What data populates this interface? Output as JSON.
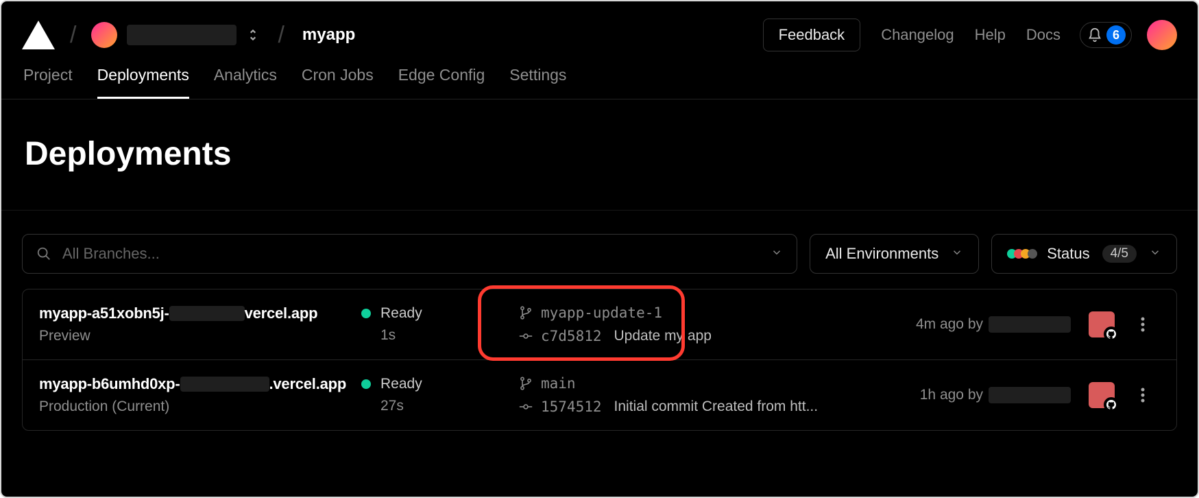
{
  "header": {
    "project_name": "myapp",
    "feedback_label": "Feedback",
    "changelog_label": "Changelog",
    "help_label": "Help",
    "docs_label": "Docs",
    "notification_count": "6"
  },
  "subnav": {
    "items": [
      "Project",
      "Deployments",
      "Analytics",
      "Cron Jobs",
      "Edge Config",
      "Settings"
    ],
    "active_index": 1
  },
  "page": {
    "title": "Deployments"
  },
  "filters": {
    "branch_placeholder": "All Branches...",
    "env_label": "All Environments",
    "status_label": "Status",
    "status_count": "4/5"
  },
  "deployments": [
    {
      "url_prefix": "myapp-a51xobn5j-",
      "url_suffix": "vercel.app",
      "environment": "Preview",
      "status": "Ready",
      "duration": "1s",
      "branch": "myapp-update-1",
      "commit_sha": "c7d5812",
      "commit_msg": "Update my app",
      "time_ago": "4m ago by"
    },
    {
      "url_prefix": "myapp-b6umhd0xp-",
      "url_suffix": ".vercel.app",
      "environment": "Production (Current)",
      "status": "Ready",
      "duration": "27s",
      "branch": "main",
      "commit_sha": "1574512",
      "commit_msg": "Initial commit Created from htt...",
      "time_ago": "1h ago by"
    }
  ]
}
